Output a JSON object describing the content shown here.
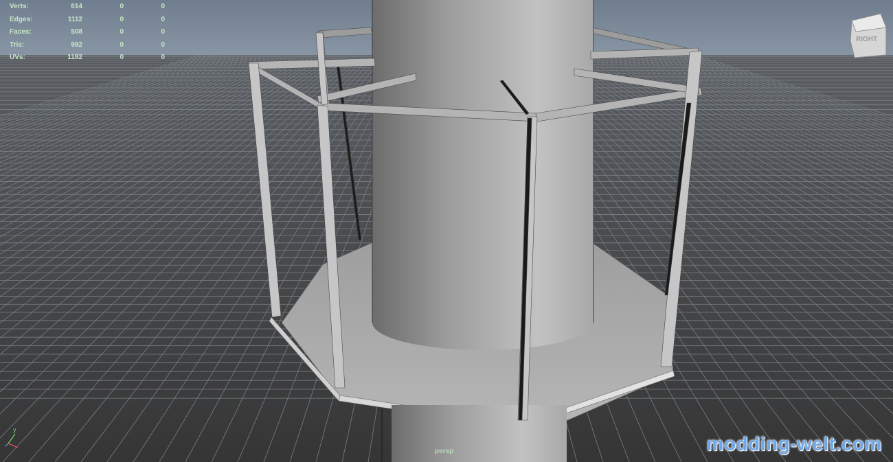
{
  "heads_up_display": {
    "rows": [
      {
        "label": "Verts:",
        "values": [
          "614",
          "0",
          "0"
        ]
      },
      {
        "label": "Edges:",
        "values": [
          "1112",
          "0",
          "0"
        ]
      },
      {
        "label": "Faces:",
        "values": [
          "508",
          "0",
          "0"
        ]
      },
      {
        "label": "Tris:",
        "values": [
          "992",
          "0",
          "0"
        ]
      },
      {
        "label": "UVs:",
        "values": [
          "1182",
          "0",
          "0"
        ]
      }
    ]
  },
  "viewport": {
    "camera_label": "persp",
    "view_cube_label": "RIGHT",
    "axis_y_label": "y"
  },
  "watermark": "modding-welt.com",
  "colors": {
    "grid_line": "#6a6a6a",
    "ground": "#3b3b3b",
    "sky": "#7e8d9e",
    "geometry": "#b8b8b8",
    "hud_text": "#c8e8c8",
    "watermark": "#6fa8e8"
  }
}
